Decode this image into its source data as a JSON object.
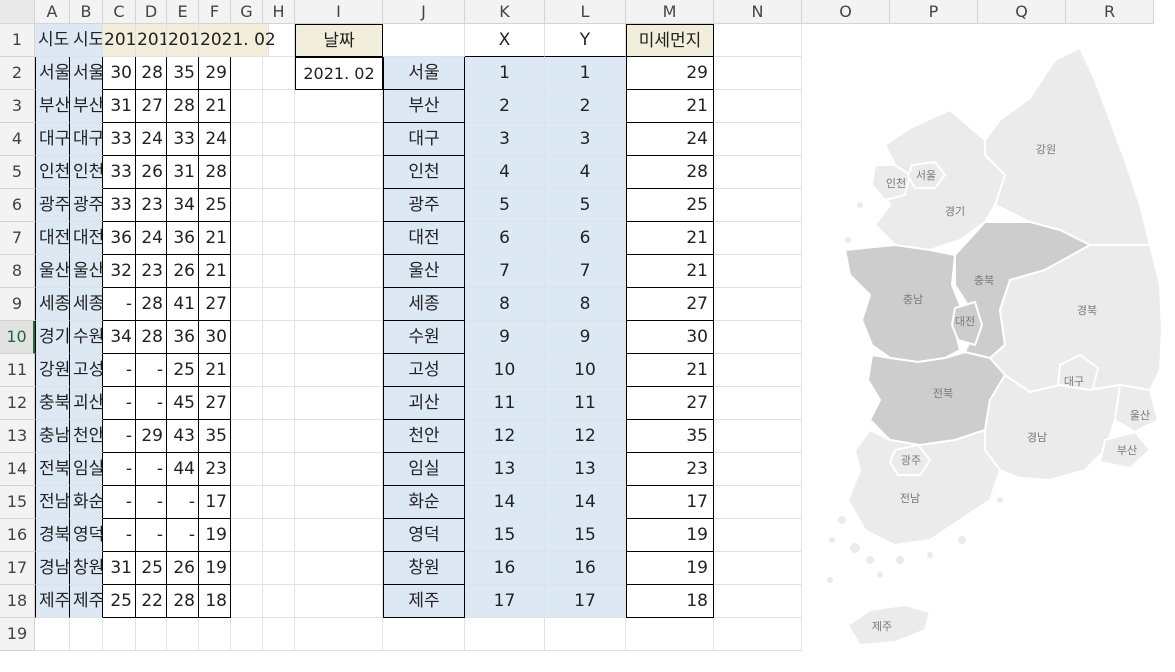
{
  "columns": [
    "A",
    "B",
    "C",
    "D",
    "E",
    "F",
    "G",
    "H",
    "I",
    "J",
    "K",
    "L",
    "M",
    "N",
    "O",
    "P",
    "Q",
    "R"
  ],
  "rows": [
    "1",
    "2",
    "3",
    "4",
    "5",
    "6",
    "7",
    "8",
    "9",
    "10",
    "11",
    "12",
    "13",
    "14",
    "15",
    "16",
    "17",
    "18",
    "19"
  ],
  "active_row": "10",
  "header_row": {
    "A": "시도",
    "B": "시도",
    "C": "201",
    "D": "201",
    "E": "201",
    "F": "2021. 02",
    "I": "날짜",
    "K": "X",
    "L": "Y",
    "M": "미세먼지"
  },
  "date_value": "2021. 02",
  "left_table": [
    {
      "a": "서울",
      "b": "서울",
      "c": "30",
      "d": "28",
      "e": "35",
      "f": "29"
    },
    {
      "a": "부산",
      "b": "부산",
      "c": "31",
      "d": "27",
      "e": "28",
      "f": "21"
    },
    {
      "a": "대구",
      "b": "대구",
      "c": "33",
      "d": "24",
      "e": "33",
      "f": "24"
    },
    {
      "a": "인천",
      "b": "인천",
      "c": "33",
      "d": "26",
      "e": "31",
      "f": "28"
    },
    {
      "a": "광주",
      "b": "광주",
      "c": "33",
      "d": "23",
      "e": "34",
      "f": "25"
    },
    {
      "a": "대전",
      "b": "대전",
      "c": "36",
      "d": "24",
      "e": "36",
      "f": "21"
    },
    {
      "a": "울산",
      "b": "울산",
      "c": "32",
      "d": "23",
      "e": "26",
      "f": "21"
    },
    {
      "a": "세종",
      "b": "세종",
      "c": "-",
      "d": "28",
      "e": "41",
      "f": "27"
    },
    {
      "a": "경기",
      "b": "수원",
      "c": "34",
      "d": "28",
      "e": "36",
      "f": "30"
    },
    {
      "a": "강원",
      "b": "고성",
      "c": "-",
      "d": "-",
      "e": "25",
      "f": "21"
    },
    {
      "a": "충북",
      "b": "괴산",
      "c": "-",
      "d": "-",
      "e": "45",
      "f": "27"
    },
    {
      "a": "충남",
      "b": "천안",
      "c": "-",
      "d": "29",
      "e": "43",
      "f": "35"
    },
    {
      "a": "전북",
      "b": "임실",
      "c": "-",
      "d": "-",
      "e": "44",
      "f": "23"
    },
    {
      "a": "전남",
      "b": "화순",
      "c": "-",
      "d": "-",
      "e": "-",
      "f": "17"
    },
    {
      "a": "경북",
      "b": "영덕",
      "c": "-",
      "d": "-",
      "e": "-",
      "f": "19"
    },
    {
      "a": "경남",
      "b": "창원",
      "c": "31",
      "d": "25",
      "e": "26",
      "f": "19"
    },
    {
      "a": "제주",
      "b": "제주",
      "c": "25",
      "d": "22",
      "e": "28",
      "f": "18"
    }
  ],
  "right_table": [
    {
      "j": "서울",
      "k": "1",
      "l": "1",
      "m": "29"
    },
    {
      "j": "부산",
      "k": "2",
      "l": "2",
      "m": "21"
    },
    {
      "j": "대구",
      "k": "3",
      "l": "3",
      "m": "24"
    },
    {
      "j": "인천",
      "k": "4",
      "l": "4",
      "m": "28"
    },
    {
      "j": "광주",
      "k": "5",
      "l": "5",
      "m": "25"
    },
    {
      "j": "대전",
      "k": "6",
      "l": "6",
      "m": "21"
    },
    {
      "j": "울산",
      "k": "7",
      "l": "7",
      "m": "21"
    },
    {
      "j": "세종",
      "k": "8",
      "l": "8",
      "m": "27"
    },
    {
      "j": "수원",
      "k": "9",
      "l": "9",
      "m": "30"
    },
    {
      "j": "고성",
      "k": "10",
      "l": "10",
      "m": "21"
    },
    {
      "j": "괴산",
      "k": "11",
      "l": "11",
      "m": "27"
    },
    {
      "j": "천안",
      "k": "12",
      "l": "12",
      "m": "35"
    },
    {
      "j": "임실",
      "k": "13",
      "l": "13",
      "m": "23"
    },
    {
      "j": "화순",
      "k": "14",
      "l": "14",
      "m": "17"
    },
    {
      "j": "영덕",
      "k": "15",
      "l": "15",
      "m": "19"
    },
    {
      "j": "창원",
      "k": "16",
      "l": "16",
      "m": "19"
    },
    {
      "j": "제주",
      "k": "17",
      "l": "17",
      "m": "18"
    }
  ],
  "map_labels": {
    "seoul": "서울",
    "incheon": "인천",
    "gyeonggi": "경기",
    "gangwon": "강원",
    "chungbuk": "충북",
    "chungnam": "충남",
    "daejeon": "대전",
    "gyeongbuk": "경북",
    "daegu": "대구",
    "ulsan": "울산",
    "jeonbuk": "전북",
    "gyeongnam": "경남",
    "busan": "부산",
    "gwangju": "광주",
    "jeonnam": "전남",
    "jeju": "제주"
  },
  "colors": {
    "light_region": "#ebebeb",
    "dark_region": "#cdcdcd",
    "region_border": "#ffffff",
    "label_text": "#7a7a7a",
    "blue_fill": "#dde8f5",
    "tan_fill": "#f2eedc"
  }
}
